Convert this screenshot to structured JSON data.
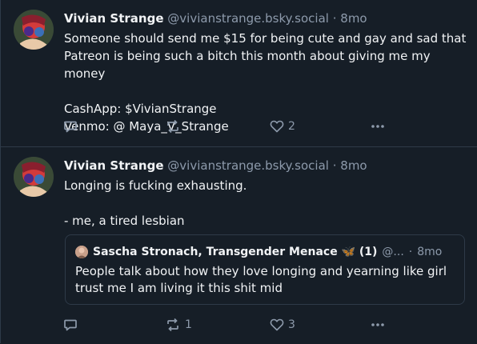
{
  "posts": [
    {
      "author": "Vivian Strange",
      "handle": "@vivianstrange.bsky.social",
      "separator": "·",
      "time": "8mo",
      "lines": [
        "Someone should send me $15 for being cute and gay and sad that",
        "Patreon is being such a bitch this month about giving me my money",
        "",
        "CashApp: $VivianStrange",
        "Venmo: @ Maya_V_Strange"
      ],
      "reply_count": "",
      "repost_count": "",
      "like_count": "2"
    },
    {
      "author": "Vivian Strange",
      "handle": "@vivianstrange.bsky.social",
      "separator": "·",
      "time": "8mo",
      "lines": [
        "Longing is fucking exhausting.",
        "",
        "- me, a tired lesbian"
      ],
      "quote": {
        "author": "Sascha Stronach, Transgender Menace 🦋 (1)",
        "handle": "@...",
        "separator": "·",
        "time": "8mo",
        "lines": [
          "People talk about how they love longing and yearning like girl",
          "trust me I am living it this shit mid"
        ]
      },
      "reply_count": "",
      "repost_count": "1",
      "like_count": "3"
    }
  ],
  "colors": {
    "background": "#161e27",
    "border": "#2e3a48",
    "text": "#f1f3f5",
    "muted": "#8d9aab"
  },
  "icons": {
    "reply": "speech-bubble-icon",
    "repost": "repost-arrows-icon",
    "like": "heart-icon",
    "more": "ellipsis-icon"
  }
}
